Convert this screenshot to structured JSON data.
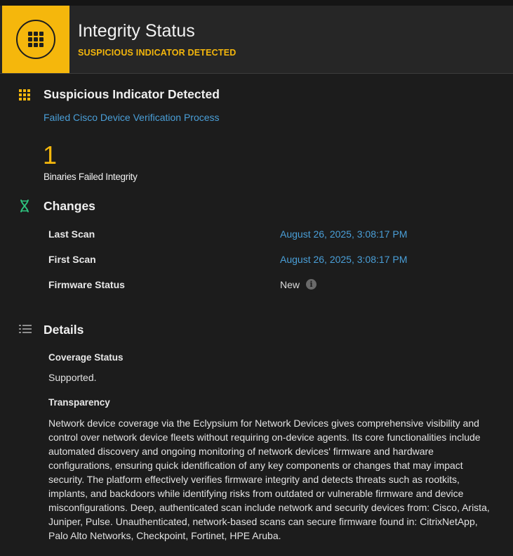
{
  "header": {
    "title": "Integrity Status",
    "subtitle": "SUSPICIOUS INDICATOR DETECTED",
    "badge_icon": "grid-icon",
    "badge_color": "#f5b70c"
  },
  "indicator": {
    "title": "Suspicious Indicator Detected",
    "link": "Failed Cisco Device Verification Process",
    "count": "1",
    "count_label": "Binaries Failed Integrity"
  },
  "changes": {
    "title": "Changes",
    "rows": [
      {
        "label": "Last Scan",
        "value": "August 26, 2025, 3:08:17 PM"
      },
      {
        "label": "First Scan",
        "value": "August 26, 2025, 3:08:17 PM"
      },
      {
        "label": "Firmware Status",
        "value": "New"
      }
    ]
  },
  "details": {
    "title": "Details",
    "coverage_label": "Coverage Status",
    "coverage_value": "Supported.",
    "transparency_label": "Transparency",
    "transparency_text": "Network device coverage via the Eclypsium for Network Devices gives comprehensive visibility and control over network device fleets without requiring on-device agents. Its core functionalities include automated discovery and ongoing monitoring of network devices' firmware and hardware configurations, ensuring quick identification of any key components or changes that may impact security. The platform effectively verifies firmware integrity and detects threats such as rootkits, implants, and backdoors while identifying risks from outdated or vulnerable firmware and device misconfigurations. Deep, authenticated scan include network and security devices from: Cisco, Arista, Juniper, Pulse. Unauthenticated, network-based scans can secure firmware found in: CitrixNetApp, Palo Alto Networks, Checkpoint, Fortinet, HPE Aruba."
  },
  "colors": {
    "accent": "#f5b70c",
    "link": "#4a9fd8",
    "changes_icon": "#2ec27e"
  }
}
